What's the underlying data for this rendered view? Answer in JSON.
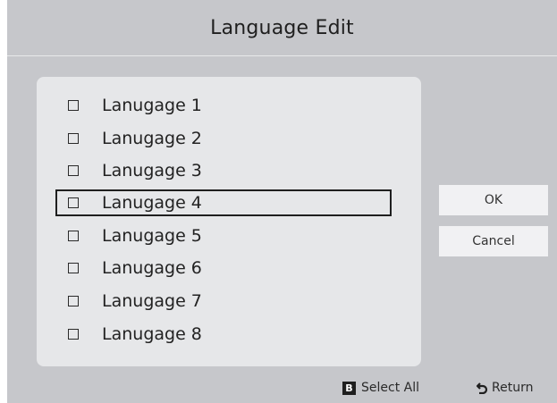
{
  "dialog": {
    "title": "Language Edit"
  },
  "list": {
    "items": [
      {
        "label": "Lanugage 1",
        "checked": false,
        "focused": false
      },
      {
        "label": "Lanugage 2",
        "checked": false,
        "focused": false
      },
      {
        "label": "Lanugage 3",
        "checked": false,
        "focused": false
      },
      {
        "label": "Lanugage 4",
        "checked": false,
        "focused": true
      },
      {
        "label": "Lanugage 5",
        "checked": false,
        "focused": false
      },
      {
        "label": "Lanugage 6",
        "checked": false,
        "focused": false
      },
      {
        "label": "Lanugage 7",
        "checked": false,
        "focused": false
      },
      {
        "label": "Lanugage 8",
        "checked": false,
        "focused": false
      }
    ]
  },
  "buttons": {
    "ok": "OK",
    "cancel": "Cancel"
  },
  "footer": {
    "select_all_key": "B",
    "select_all": "Select All",
    "return": "Return",
    "return_icon": "return-arrow-icon"
  },
  "colors": {
    "background": "#c6c7cb",
    "panel": "#e6e7e9",
    "button": "#f1f1f3",
    "focus_border": "#1f1f1f"
  }
}
